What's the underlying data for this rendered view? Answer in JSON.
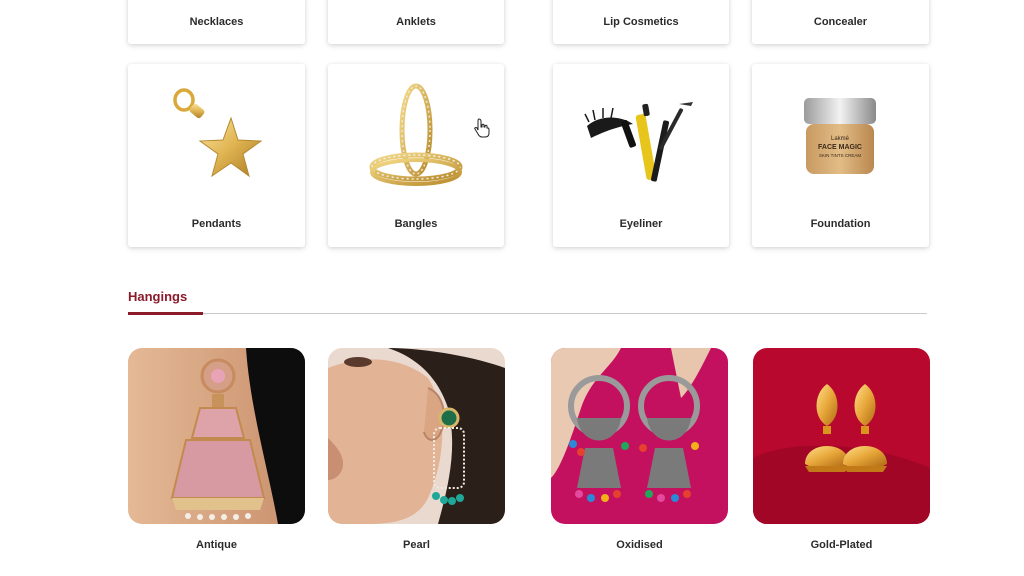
{
  "top_categories": [
    "Necklaces",
    "Anklets",
    "Lip Cosmetics",
    "Concealer"
  ],
  "mid_categories": [
    {
      "label": "Pendants",
      "icon": "star-pendant-image"
    },
    {
      "label": "Bangles",
      "icon": "bangles-image"
    },
    {
      "label": "Eyeliner",
      "icon": "eyeliner-mascara-image"
    },
    {
      "label": "Foundation",
      "icon": "foundation-jar-image"
    }
  ],
  "foundation_jar_text": {
    "brand": "Lakmé",
    "name": "FACE MAGIC",
    "sub": "SKIN TINTS CREAM"
  },
  "section": {
    "title": "Hangings"
  },
  "hangings": [
    "Antique",
    "Pearl",
    "Oxidised",
    "Gold-Plated"
  ],
  "colors": {
    "accent": "#8b1a2b",
    "oxidised_bg": "#c4115f",
    "goldplated_bg": "#b8082e"
  }
}
